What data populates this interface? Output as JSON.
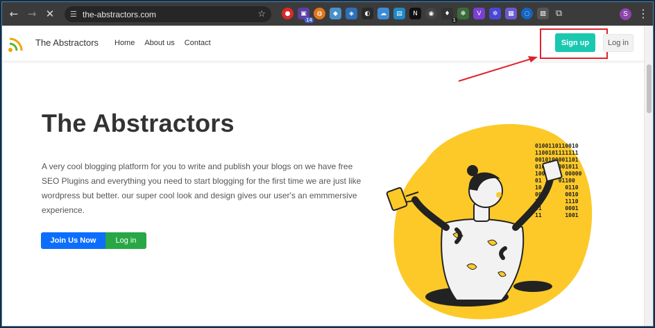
{
  "browser": {
    "url": "the-abstractors.com",
    "tab_badge": "14",
    "ext_badge": "1",
    "profile_initial": "S"
  },
  "nav": {
    "brand": "The Abstractors",
    "links": [
      "Home",
      "About us",
      "Contact"
    ],
    "signup_label": "Sign up",
    "login_label": "Log in"
  },
  "hero": {
    "title": "The Abstractors",
    "description": "A very cool blogging platform for you to write and publish your blogs on we have free SEO Plugins and everything you need to start blogging for the first time we are just like wordpress but better. our super cool look and design gives our user's an emmmersive experience.",
    "join_label": "Join Us Now",
    "login_label": "Log in"
  },
  "binary": [
    "0100110110010",
    "1100101111111",
    "0010100001101",
    "0101010001011",
    "100      00000",
    "01     01100",
    "10       0110",
    "00       0010",
    "11       1110",
    "01       0001",
    "11       1001"
  ],
  "colors": {
    "accent_signup": "#1ac8b0",
    "primary": "#0d6efd",
    "success": "#27a745",
    "highlight": "#e1202a",
    "blob": "#fcc928"
  }
}
